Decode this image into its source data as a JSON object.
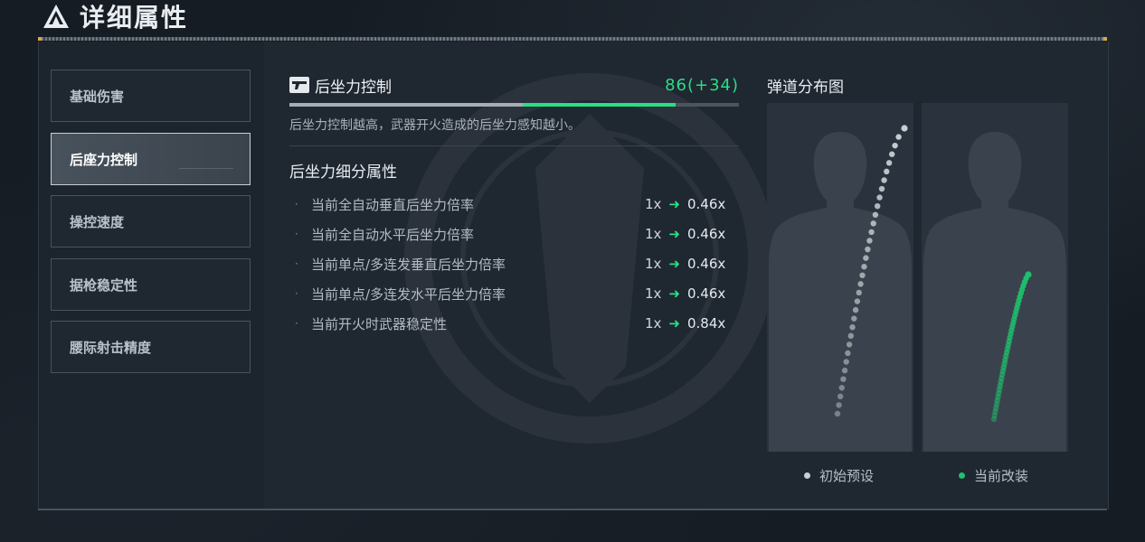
{
  "header": {
    "title": "详细属性",
    "logo_icon": "triangle-logo-icon"
  },
  "sidebar": {
    "items": [
      {
        "label": "基础伤害",
        "active": false
      },
      {
        "label": "后座力控制",
        "active": true
      },
      {
        "label": "操控速度",
        "active": false
      },
      {
        "label": "据枪稳定性",
        "active": false
      },
      {
        "label": "腰际射击精度",
        "active": false
      }
    ]
  },
  "stat": {
    "icon": "pistol-icon",
    "name": "后坐力控制",
    "value_text": "86(+34)",
    "base_fraction": 0.52,
    "total_fraction": 0.86,
    "description": "后坐力控制越高，武器开火造成的后坐力感知越小。"
  },
  "sub_section": {
    "title": "后坐力细分属性",
    "rows": [
      {
        "label": "当前全自动垂直后坐力倍率",
        "from": "1x",
        "to": "0.46x"
      },
      {
        "label": "当前全自动水平后坐力倍率",
        "from": "1x",
        "to": "0.46x"
      },
      {
        "label": "当前单点/多连发垂直后坐力倍率",
        "from": "1x",
        "to": "0.46x"
      },
      {
        "label": "当前单点/多连发水平后坐力倍率",
        "from": "1x",
        "to": "0.46x"
      },
      {
        "label": "当前开火时武器稳定性",
        "from": "1x",
        "to": "0.84x"
      }
    ],
    "bullet_char": "·",
    "arrow_char": "➜"
  },
  "trajectory": {
    "title": "弹道分布图",
    "legend_default": "初始预设",
    "legend_current": "当前改装",
    "default_color": "#c9ced3",
    "current_color": "#1fbf6d"
  },
  "colors": {
    "accent": "#28df84",
    "panel": "#1f2731"
  }
}
